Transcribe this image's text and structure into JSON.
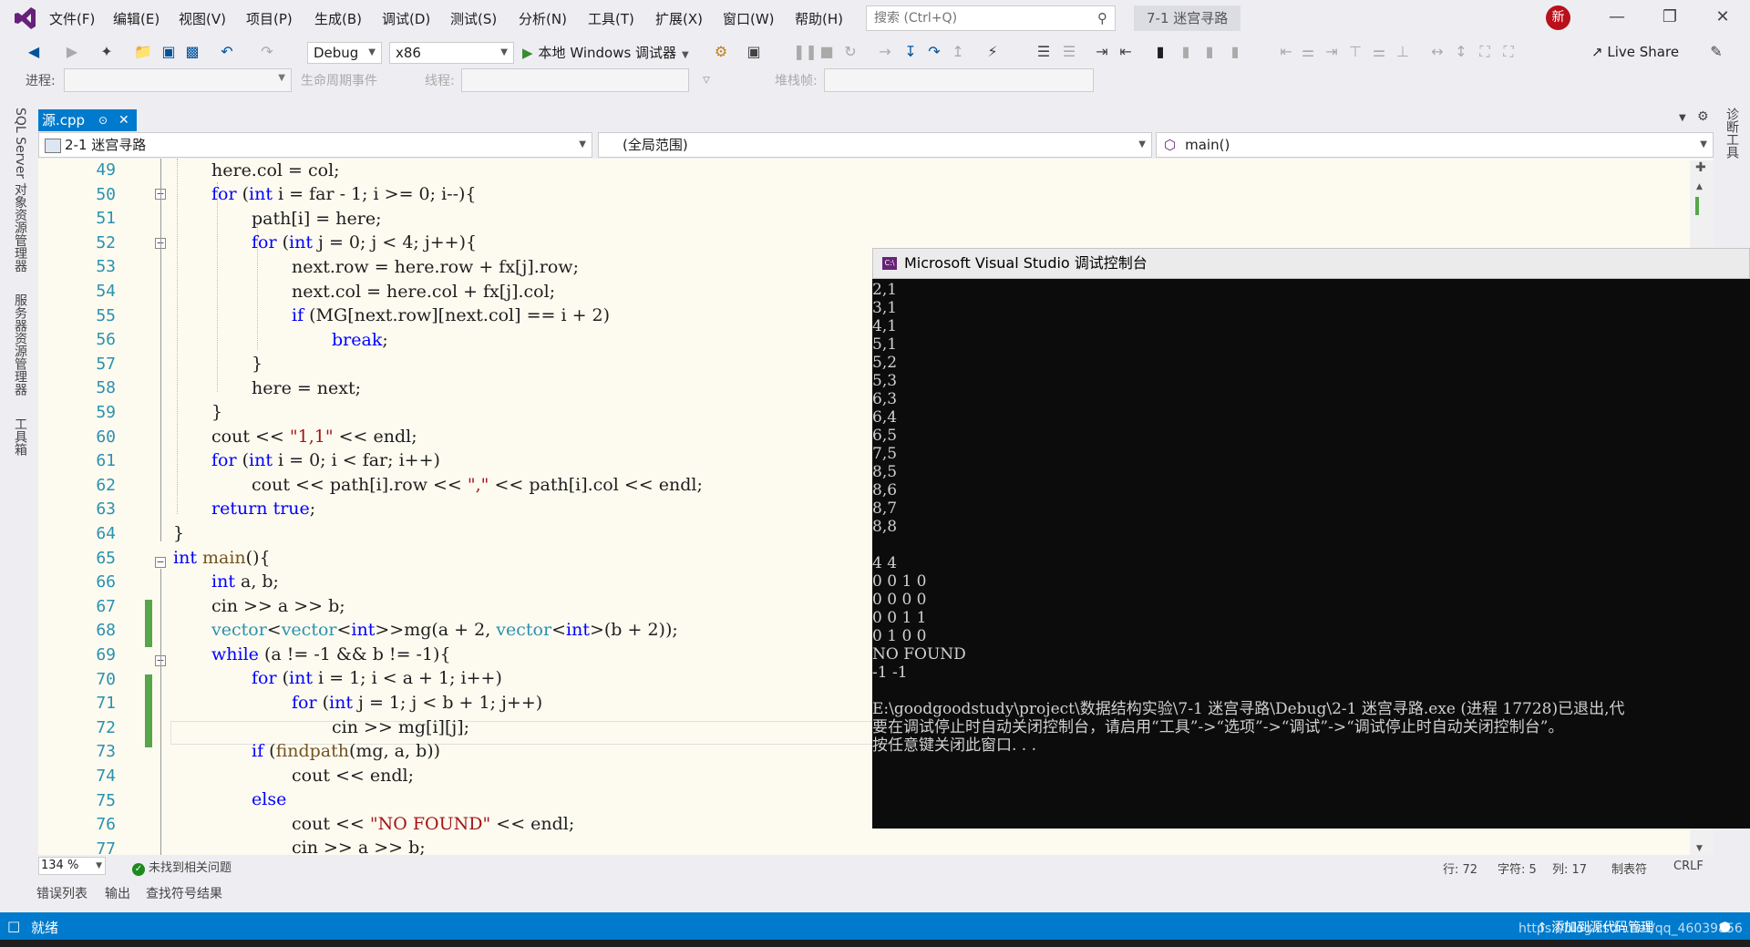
{
  "menu": {
    "items": [
      "文件(F)",
      "编辑(E)",
      "视图(V)",
      "项目(P)",
      "生成(B)",
      "调试(D)",
      "测试(S)",
      "分析(N)",
      "工具(T)",
      "扩展(X)",
      "窗口(W)",
      "帮助(H)"
    ],
    "search_placeholder": "搜索 (Ctrl+Q)",
    "project_title": "7-1 迷宫寻路",
    "avatar_text": "新"
  },
  "toolbar": {
    "config": "Debug",
    "platform": "x86",
    "run_label": "本地 Windows 调试器",
    "live_share": "Live Share"
  },
  "debug_row": {
    "process_label": "进程:",
    "lifecycle_label": "生命周期事件",
    "thread_label": "线程:",
    "stack_label": "堆栈帧:"
  },
  "sidebar": {
    "left_tabs": [
      "SQL Server 对象资源管理器",
      "服务器资源管理器",
      "工具箱"
    ],
    "right_tab": "诊断工具"
  },
  "document": {
    "tab_name": "源.cpp",
    "nav_project": "2-1 迷宫寻路",
    "nav_scope": "(全局范围)",
    "nav_function": "main()"
  },
  "editor": {
    "line_numbers": [
      "49",
      "50",
      "51",
      "52",
      "53",
      "54",
      "55",
      "56",
      "57",
      "58",
      "59",
      "60",
      "61",
      "62",
      "63",
      "64",
      "65",
      "66",
      "67",
      "68",
      "69",
      "70",
      "71",
      "72",
      "73",
      "74",
      "75",
      "76",
      "77"
    ],
    "zoom": "134 %",
    "issues": "未找到相关问题",
    "row": "行: 72",
    "char": "字符: 5",
    "col": "列: 17",
    "tab_mode": "制表符",
    "line_ending": "CRLF"
  },
  "console": {
    "title": "Microsoft Visual Studio 调试控制台",
    "lines": [
      "2,1",
      "3,1",
      "4,1",
      "5,1",
      "5,2",
      "5,3",
      "6,3",
      "6,4",
      "6,5",
      "7,5",
      "8,5",
      "8,6",
      "8,7",
      "8,8",
      "",
      "4 4",
      "0 0 1 0",
      "0 0 0 0",
      "0 0 1 1",
      "0 1 0 0",
      "NO FOUND",
      "-1 -1",
      "",
      "E:\\goodgoodstudy\\project\\数据结构实验\\7-1 迷宫寻路\\Debug\\2-1 迷宫寻路.exe (进程 17728)已退出,代",
      "要在调试停止时自动关闭控制台，请启用“工具”->“选项”->“调试”->“调试停止时自动关闭控制台”。",
      "按任意键关闭此窗口. . ."
    ]
  },
  "bottom_tabs": [
    "错误列表",
    "输出",
    "查找符号结果"
  ],
  "status": {
    "ready": "就绪",
    "source_control": "添加到源代码管理",
    "watermark": "https://blog.csdn.net/qq_46039856"
  }
}
